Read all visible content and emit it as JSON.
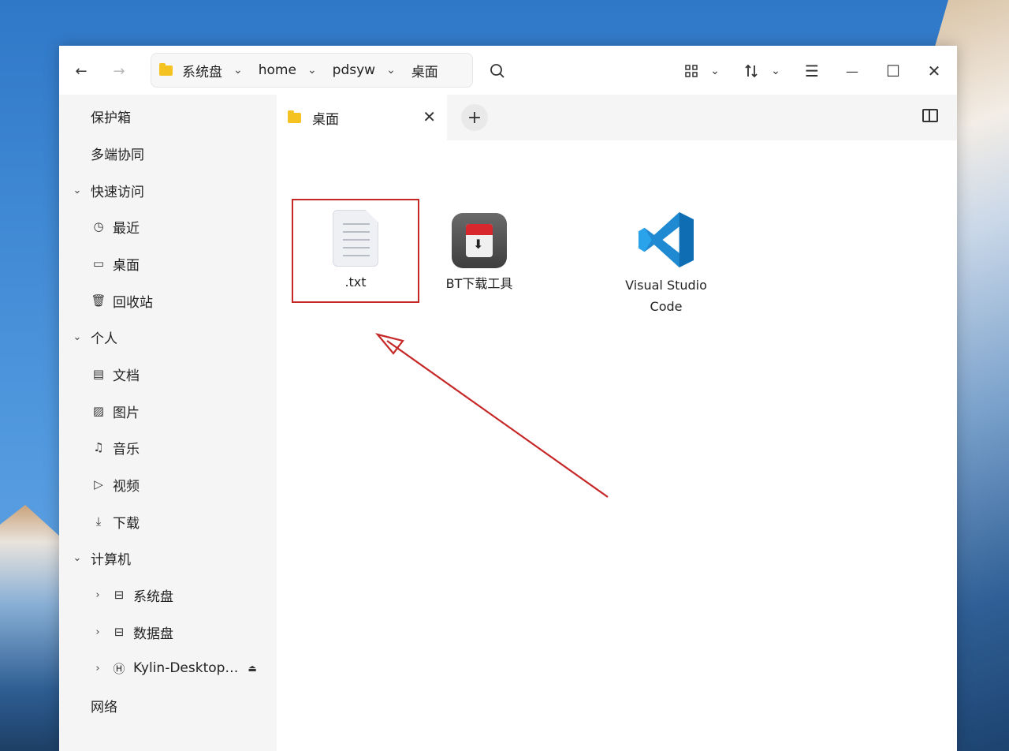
{
  "titlebar": {
    "back_icon": "←",
    "forward_icon": "→",
    "breadcrumbs": [
      "系统盘",
      "home",
      "pdsyw",
      "桌面"
    ],
    "view_icon": "grid-view-icon",
    "sort_icon": "sort-icon",
    "menu_icon": "☰",
    "minimize_icon": "—",
    "maximize_icon": "☐",
    "close_icon": "✕"
  },
  "sidebar": {
    "vault": "保护箱",
    "multi_device": "多端协同",
    "quick_access": {
      "label": "快速访问",
      "items": [
        "最近",
        "桌面",
        "回收站"
      ]
    },
    "personal": {
      "label": "个人",
      "items": [
        "文档",
        "图片",
        "音乐",
        "视频",
        "下载"
      ]
    },
    "computer": {
      "label": "计算机",
      "items": [
        "系统盘",
        "数据盘",
        "Kylin-Desktop…"
      ]
    },
    "network": "网络"
  },
  "tabs": {
    "active_tab": "桌面",
    "close_icon": "✕",
    "add_icon": "+"
  },
  "files": [
    {
      "name": ".txt",
      "type": "text-file"
    },
    {
      "name": "BT下载工具",
      "type": "app"
    },
    {
      "name_line1": "Visual Studio",
      "name_line2": "Code",
      "type": "app"
    }
  ],
  "colors": {
    "accent_folder": "#f4c321",
    "annotation_red": "#c62828",
    "vscode_blue": "#1f8ad2"
  }
}
